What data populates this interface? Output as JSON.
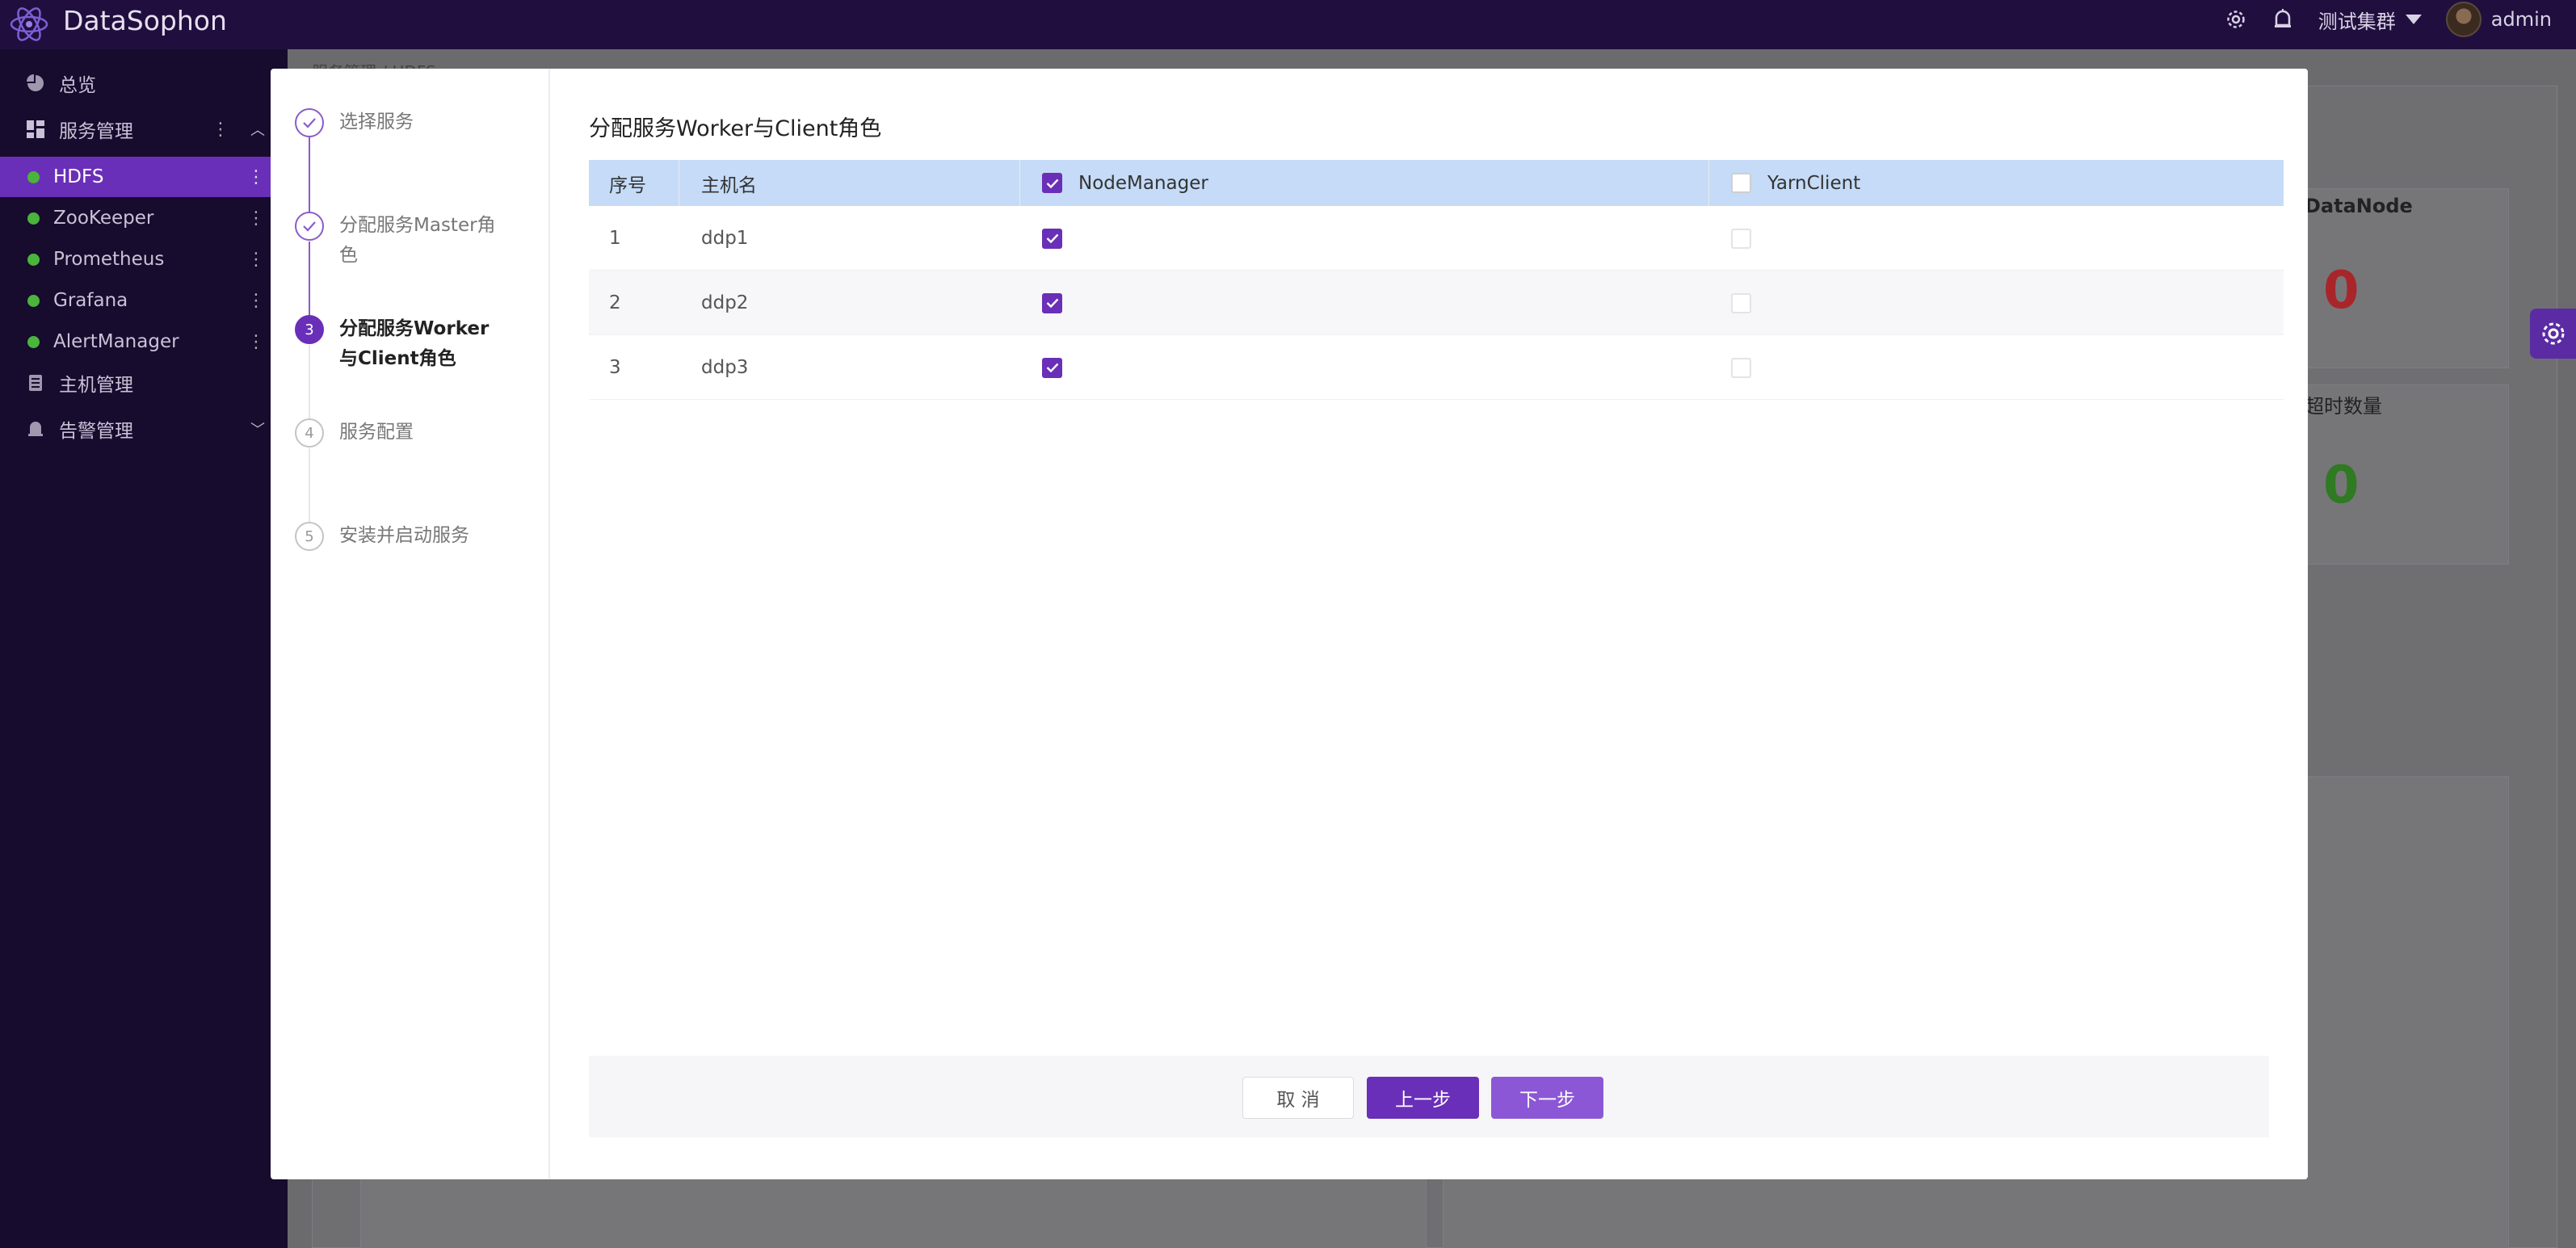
{
  "app": {
    "name": "DataSophon"
  },
  "header": {
    "cluster": "测试集群",
    "user": "admin"
  },
  "sidebar": {
    "overview": "总览",
    "service_mgmt": "服务管理",
    "services": [
      "HDFS",
      "ZooKeeper",
      "Prometheus",
      "Grafana",
      "AlertManager"
    ],
    "host_mgmt": "主机管理",
    "alert_mgmt": "告警管理"
  },
  "background": {
    "breadcrumb": "服务管理 / HDFS",
    "card1_label": "DataNode",
    "card1_value": "0",
    "card2_label": "超时数量",
    "card2_value": "0"
  },
  "wizard": {
    "steps": [
      {
        "num": "1",
        "label": "选择服务",
        "status": "finish"
      },
      {
        "num": "2",
        "label": "分配服务Master角色",
        "status": "finish"
      },
      {
        "num": "3",
        "label": "分配服务Worker与Client角色",
        "status": "current"
      },
      {
        "num": "4",
        "label": "服务配置",
        "status": "wait"
      },
      {
        "num": "5",
        "label": "安装并启动服务",
        "status": "wait"
      }
    ],
    "title": "分配服务Worker与Client角色",
    "table": {
      "headers": {
        "index": "序号",
        "hostname": "主机名",
        "role1": "NodeManager",
        "role2": "YarnClient"
      },
      "header_checked": {
        "role1": true,
        "role2": false
      },
      "rows": [
        {
          "index": "1",
          "host": "ddp1",
          "role1": true,
          "role2": false
        },
        {
          "index": "2",
          "host": "ddp2",
          "role1": true,
          "role2": false
        },
        {
          "index": "3",
          "host": "ddp3",
          "role1": true,
          "role2": false
        }
      ]
    },
    "buttons": {
      "cancel": "取 消",
      "prev": "上一步",
      "next": "下一步"
    }
  },
  "colors": {
    "accent": "#6a2fb8",
    "header_bg": "#200f3e",
    "sidebar_bg": "#170b2e",
    "table_header": "#c5dbf7",
    "status_green": "#4ab43c",
    "value_red": "#c0282a"
  }
}
